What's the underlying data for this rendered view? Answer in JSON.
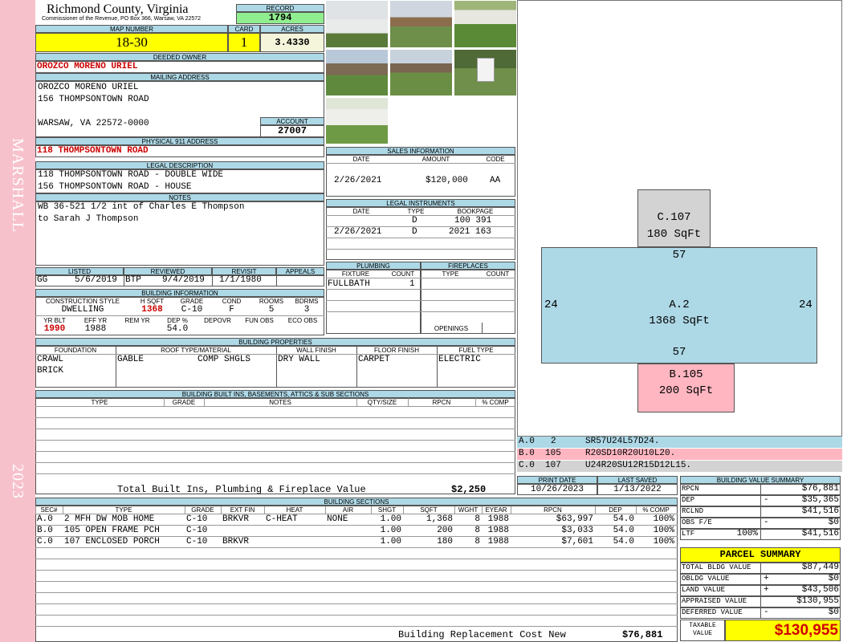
{
  "side": {
    "district": "MARSHALL",
    "year": "2023"
  },
  "header": {
    "county": "Richmond County, Virginia",
    "commissioner": "Commissioner of the Revenue, PO Box 366, Warsaw, VA 22572",
    "record_label": "RECORD",
    "record": "1794"
  },
  "map": {
    "map_label": "MAP NUMBER",
    "map_number": "18-30",
    "card_label": "CARD",
    "card": "1",
    "acres_label": "ACRES",
    "acres": "3.4330"
  },
  "owner": {
    "deeded_label": "DEEDED OWNER",
    "deeded": "OROZCO MORENO URIEL",
    "mailing_label": "MAILING ADDRESS",
    "mail1": "OROZCO MORENO URIEL",
    "mail2": "156 THOMPSONTOWN ROAD",
    "mail3": "WARSAW, VA 22572-0000",
    "account_label": "ACCOUNT",
    "account": "27007"
  },
  "physical": {
    "label": "PHYSICAL 911 ADDRESS",
    "address": "118 THOMPSONTOWN ROAD"
  },
  "legal": {
    "label": "LEGAL DESCRIPTION",
    "line1": "118 THOMPSONTOWN ROAD - DOUBLE WIDE",
    "line2": "156 THOMPSONTOWN ROAD - HOUSE"
  },
  "notes": {
    "label": "NOTES",
    "line1": "WB 36-521 1/2 int of Charles E Thompson",
    "line2": "to Sarah J Thompson"
  },
  "dates": {
    "listed_label": "LISTED",
    "reviewed_label": "REVIEWED",
    "revisit_label": "REVISIT",
    "appeals_label": "APPEALS",
    "listed_by": "GG",
    "listed": "5/6/2019",
    "reviewed_by": "BTP",
    "reviewed": "9/4/2019",
    "revisit": "1/1/1980"
  },
  "building_info": {
    "label": "BUILDING INFORMATION",
    "h_style": "CONSTRUCTION STYLE",
    "h_hsqft": "H SQFT",
    "h_grade": "GRADE",
    "h_cond": "COND",
    "h_rooms": "ROOMS",
    "h_bdrms": "BDRMS",
    "style": "DWELLING",
    "hsqft": "1368",
    "grade": "C-10",
    "cond": "F",
    "rooms": "5",
    "bdrms": "3",
    "h_yrblt": "YR BLT",
    "h_effyr": "EFF YR",
    "h_remyr": "REM YR",
    "h_dep": "DEP %",
    "h_depovr": "DEPOVR",
    "h_funobs": "FUN OBS",
    "h_ecoobs": "ECO OBS",
    "yrblt": "1990",
    "effyr": "1988",
    "dep": "54.0"
  },
  "sales": {
    "label": "SALES INFORMATION",
    "h_date": "DATE",
    "h_amount": "AMOUNT",
    "h_code": "CODE",
    "date": "2/26/2021",
    "amount": "$120,000",
    "code": "AA"
  },
  "instruments": {
    "label": "LEGAL INSTRUMENTS",
    "h_date": "DATE",
    "h_type": "TYPE",
    "h_book": "BOOKPAGE",
    "rows": [
      {
        "date": "",
        "type": "D",
        "book": "100 391"
      },
      {
        "date": "2/26/2021",
        "type": "D",
        "book": "2021 163"
      }
    ]
  },
  "plumbing": {
    "label": "PLUMBING",
    "h_fixture": "FIXTURE",
    "h_count": "COUNT",
    "fixture": "FULLBATH",
    "count": "1"
  },
  "fireplaces": {
    "label": "FIREPLACES",
    "h_type": "TYPE",
    "h_count": "COUNT",
    "openings_label": "OPENINGS"
  },
  "properties": {
    "label": "BUILDING PROPERTIES",
    "h_foundation": "FOUNDATION",
    "h_roof": "ROOF TYPE/MATERIAL",
    "h_wall": "WALL FINISH",
    "h_floor": "FLOOR FINISH",
    "h_fuel": "FUEL TYPE",
    "foundation1": "CRAWL",
    "foundation2": "BRICK",
    "roof_type": "GABLE",
    "roof_material": "COMP SHGLS",
    "wall": "DRY WALL",
    "floor": "CARPET",
    "fuel": "ELECTRIC"
  },
  "builtins": {
    "label": "BUILDING BUILT INS, BASEMENTS, ATTICS & SUB SECTIONS",
    "h_type": "TYPE",
    "h_grade": "GRADE",
    "h_notes": "NOTES",
    "h_qty": "QTY/SIZE",
    "h_rpcn": "RPCN",
    "h_comp": "% COMP",
    "total_label": "Total Built Ins, Plumbing & Fireplace Value",
    "total": "$2,250"
  },
  "print": {
    "print_label": "PRINT DATE",
    "saved_label": "LAST SAVED",
    "print_date": "10/26/2023",
    "last_saved": "1/13/2022"
  },
  "sketch": {
    "c_name": "C.107",
    "c_area": "180 SqFt",
    "a_name": "A.2",
    "a_area": "1368 SqFt",
    "b_name": "B.105",
    "b_area": "200 SqFt",
    "top": "57",
    "bottom": "57",
    "left": "24",
    "right": "24",
    "lines": [
      {
        "sec": "A.0",
        "code": "2",
        "path": "SR57U24L57D24."
      },
      {
        "sec": "B.0",
        "code": "105",
        "path": "R20SD10R20U10L20."
      },
      {
        "sec": "C.0",
        "code": "107",
        "path": "U24R20SU12R15D12L15."
      }
    ]
  },
  "sections": {
    "label": "BUILDING SECTIONS",
    "headers": {
      "sec": "SEC#",
      "type": "TYPE",
      "grade": "GRADE",
      "extfin": "EXT FIN",
      "heat": "HEAT",
      "air": "AIR",
      "shgt": "SHGT",
      "sqft": "SQFT",
      "wght": "WGHT",
      "eyear": "EYEAR",
      "rpcn": "RPCN",
      "dep": "DEP",
      "comp": "% COMP"
    },
    "rows": [
      {
        "sec": "A.0",
        "type": "2 MFH DW MOB HOME",
        "grade": "C-10",
        "extfin": "BRKVR",
        "heat": "C-HEAT",
        "air": "NONE",
        "shgt": "1.00",
        "sqft": "1,368",
        "wght": "8",
        "eyear": "1988",
        "rpcn": "$63,997",
        "dep": "54.0",
        "comp": "100%"
      },
      {
        "sec": "B.0",
        "type": "105 OPEN FRAME PCH",
        "grade": "C-10",
        "extfin": "",
        "heat": "",
        "air": "",
        "shgt": "1.00",
        "sqft": "200",
        "wght": "8",
        "eyear": "1988",
        "rpcn": "$3,033",
        "dep": "54.0",
        "comp": "100%"
      },
      {
        "sec": "C.0",
        "type": "107 ENCLOSED PORCH",
        "grade": "C-10",
        "extfin": "BRKVR",
        "heat": "",
        "air": "",
        "shgt": "1.00",
        "sqft": "180",
        "wght": "8",
        "eyear": "1988",
        "rpcn": "$7,601",
        "dep": "54.0",
        "comp": "100%"
      }
    ],
    "replacement_label": "Building Replacement Cost New",
    "replacement": "$76,881"
  },
  "value_summary": {
    "label": "BUILDING VALUE SUMMARY",
    "rows": [
      {
        "label": "RPCN",
        "sign": "",
        "pct": "",
        "value": "$76,881"
      },
      {
        "label": "DEP",
        "sign": "-",
        "pct": "",
        "value": "$35,365"
      },
      {
        "label": "RCLND",
        "sign": "",
        "pct": "",
        "value": "$41,516"
      },
      {
        "label": "OBS F/E",
        "sign": "-",
        "pct": "",
        "value": "$0"
      },
      {
        "label": "LTF",
        "sign": "",
        "pct": "100%",
        "value": "$41,516"
      }
    ]
  },
  "parcel": {
    "title": "PARCEL SUMMARY",
    "rows": [
      {
        "label": "TOTAL BLDG VALUE",
        "sign": "",
        "value": "$87,449"
      },
      {
        "label": "OBLDG VALUE",
        "sign": "+",
        "value": "$0"
      },
      {
        "label": "LAND VALUE",
        "sign": "+",
        "value": "$43,506"
      },
      {
        "label": "APPRAISED VALUE",
        "sign": "",
        "value": "$130,955"
      },
      {
        "label": "DEFERRED VALUE",
        "sign": "-",
        "value": "$0"
      }
    ],
    "taxable_label1": "TAXABLE",
    "taxable_label2": "VALUE",
    "taxable": "$130,955"
  }
}
